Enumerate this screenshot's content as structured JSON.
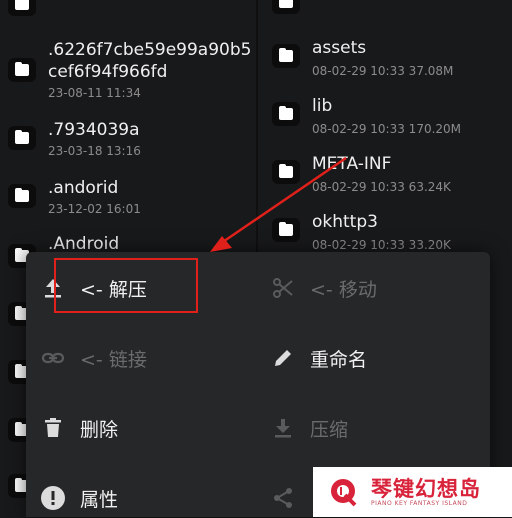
{
  "left_files": [
    {
      "name": ".6226f7cbe59e99a90b5",
      "name2": "cef6f94f966fd",
      "meta": "23-08-11 11:34"
    },
    {
      "name": ".7934039a",
      "meta": "23-03-18 13:16"
    },
    {
      "name": ".andorid",
      "meta": "23-12-02 16:01"
    },
    {
      "name": ".Android",
      "meta": ""
    }
  ],
  "right_files": [
    {
      "name": "assets",
      "meta": "08-02-29 10:33 37.08M"
    },
    {
      "name": "lib",
      "meta": "08-02-29 10:33 170.20M"
    },
    {
      "name": "META-INF",
      "meta": "08-02-29 10:33 63.24K"
    },
    {
      "name": "okhttp3",
      "meta": "08-02-29 10:33 33.20K"
    }
  ],
  "menu": {
    "extract": "<- 解压",
    "move": "<- 移动",
    "link": "<- 链接",
    "rename": "重命名",
    "delete": "删除",
    "compress": "压缩",
    "properties": "属性"
  },
  "watermark": {
    "title": "琴键幻想岛",
    "subtitle": "PIANO KEY FANTASY ISLAND"
  },
  "colors": {
    "annotation_red": "#e0201a",
    "watermark_red": "#d8233a",
    "menu_bg": "#262728"
  }
}
